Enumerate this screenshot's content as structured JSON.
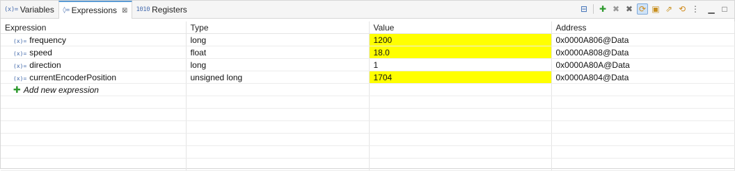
{
  "tabs": [
    {
      "icon": "(x)=",
      "label": "Variables",
      "active": false
    },
    {
      "icon": "◊=",
      "label": "Expressions",
      "active": true
    },
    {
      "icon": "1010",
      "label": "Registers",
      "active": false
    }
  ],
  "close_glyph": "⊠",
  "toolbar": [
    {
      "name": "collapse-all-icon",
      "glyph": "⊟",
      "color": "#3b6db5"
    },
    {
      "name": "add-expression-icon",
      "glyph": "✚",
      "color": "#2e9a2e"
    },
    {
      "name": "remove-icon",
      "glyph": "✖",
      "color": "#9a9a9a"
    },
    {
      "name": "remove-all-icon",
      "glyph": "✖",
      "color": "#6a6a6a"
    },
    {
      "name": "continuous-refresh-icon",
      "glyph": "⟳",
      "color": "#d08a1a",
      "pressed": true
    },
    {
      "name": "new-group-icon",
      "glyph": "▣",
      "color": "#c89020"
    },
    {
      "name": "export-icon",
      "glyph": "⇗",
      "color": "#c89020"
    },
    {
      "name": "refresh-icon",
      "glyph": "⟲",
      "color": "#d08a1a"
    },
    {
      "name": "view-menu-icon",
      "glyph": "⋮",
      "color": "#555555"
    },
    {
      "name": "minimize-icon",
      "glyph": "▁",
      "color": "#555555"
    },
    {
      "name": "maximize-icon",
      "glyph": "□",
      "color": "#555555"
    }
  ],
  "columns": [
    "Expression",
    "Type",
    "Value",
    "Address"
  ],
  "rows": [
    {
      "expression": "frequency",
      "type": "long",
      "value": "1200",
      "address": "0x0000A806@Data",
      "changed": true
    },
    {
      "expression": "speed",
      "type": "float",
      "value": "18.0",
      "address": "0x0000A808@Data",
      "changed": true
    },
    {
      "expression": "direction",
      "type": "long",
      "value": "1",
      "address": "0x0000A80A@Data",
      "changed": false
    },
    {
      "expression": "currentEncoderPosition",
      "type": "unsigned long",
      "value": "1704",
      "address": "0x0000A804@Data",
      "changed": true
    }
  ],
  "var_icon": "(x)=",
  "add_row": {
    "icon": "✚",
    "label": "Add new expression"
  },
  "empty_rows": 6,
  "highlight_color": "#ffff00"
}
